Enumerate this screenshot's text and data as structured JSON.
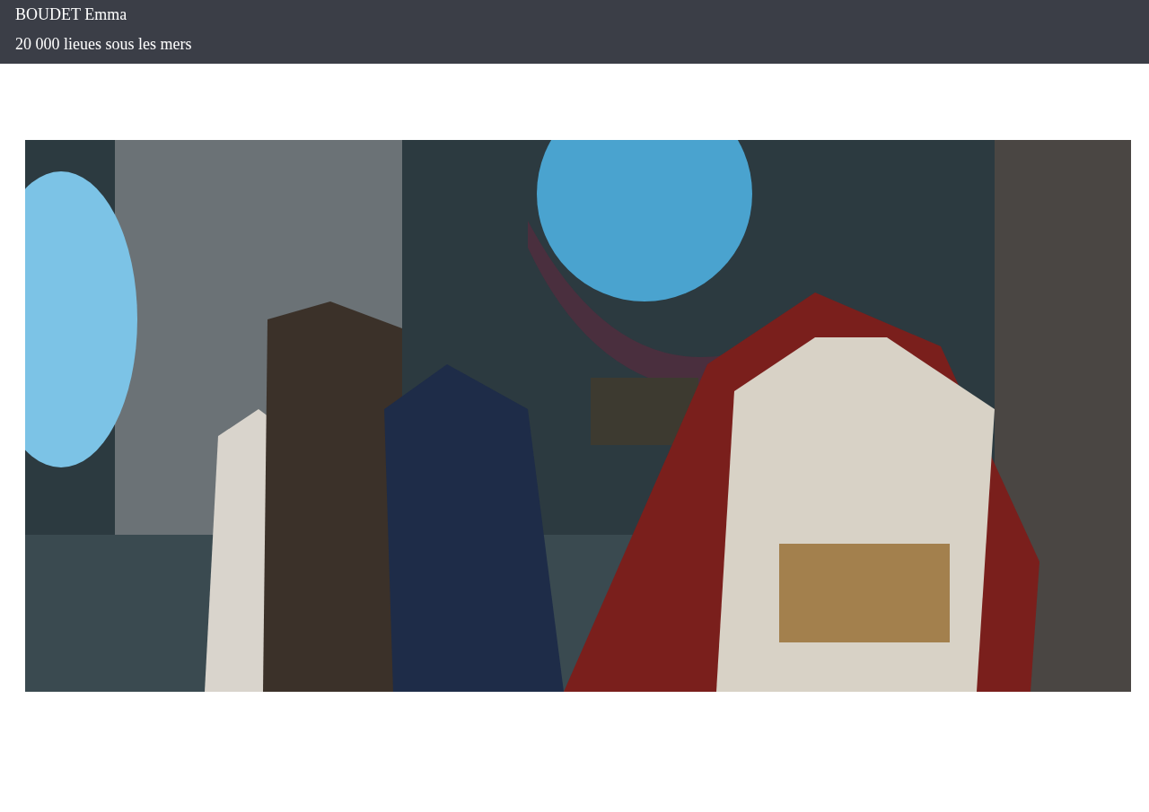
{
  "header": {
    "author": "BOUDET Emma",
    "title": "20 000 lieues sous les mers"
  }
}
